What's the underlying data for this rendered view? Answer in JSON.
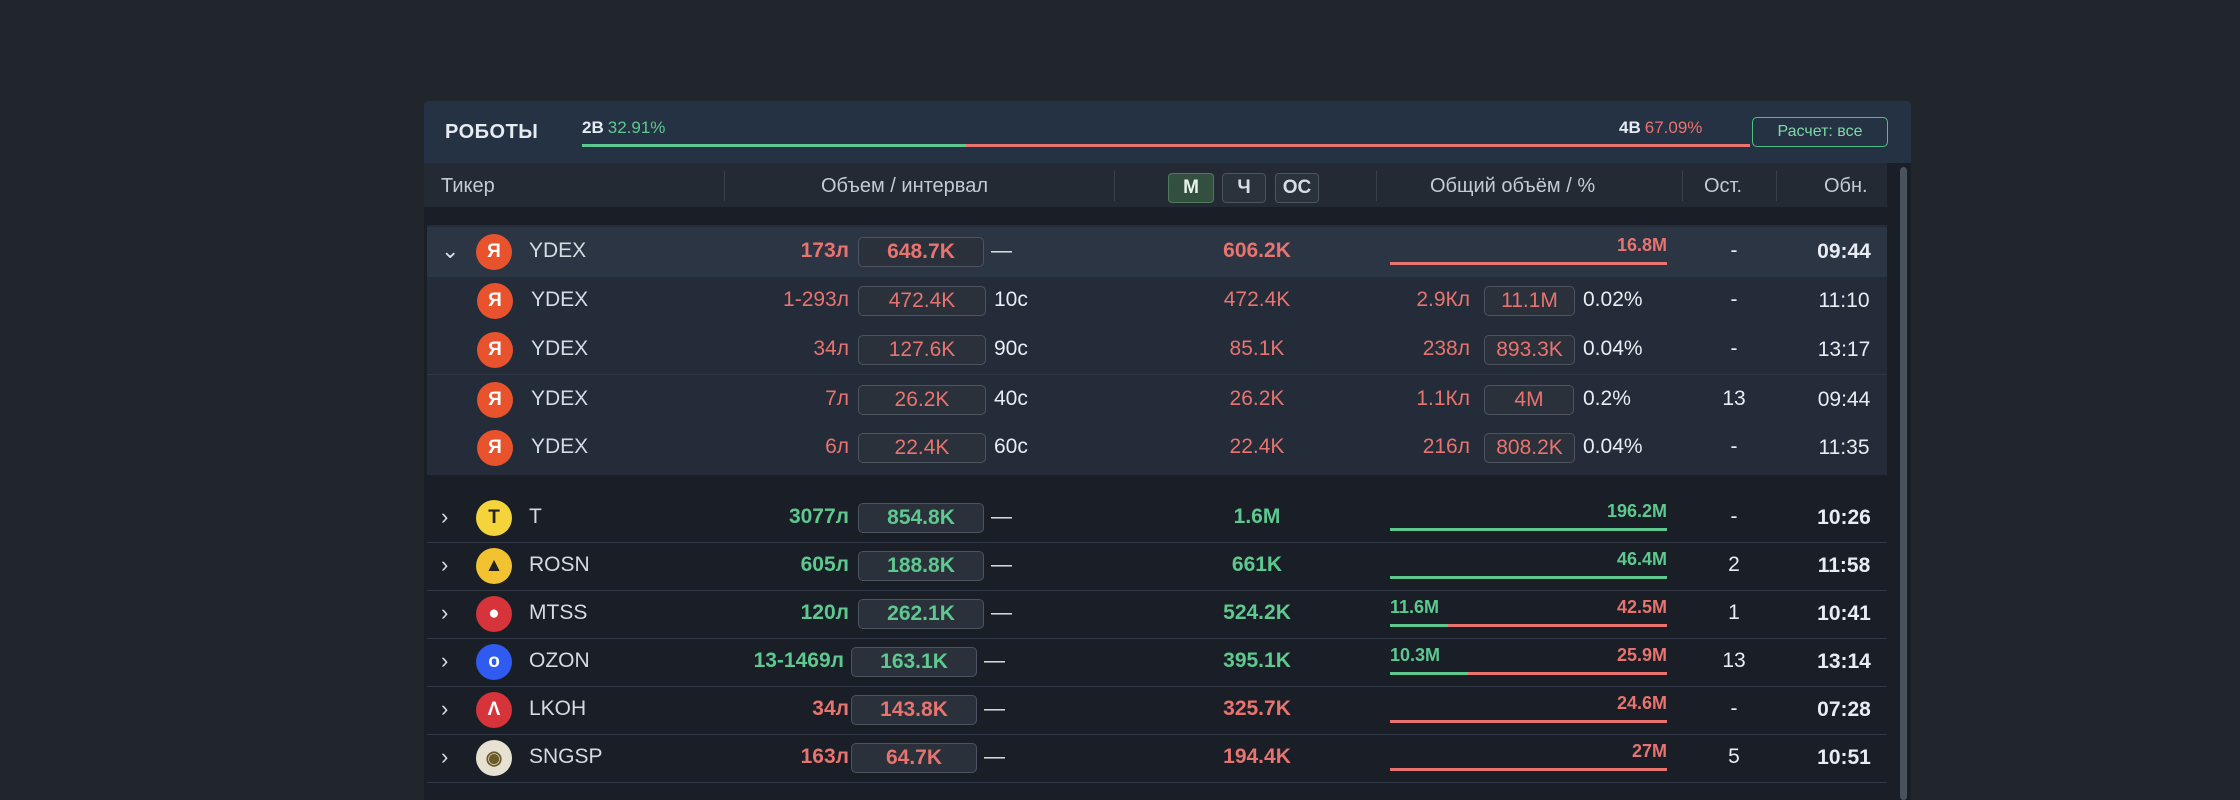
{
  "robots": {
    "title": "РОБОТЫ",
    "buy_label": "2B",
    "buy_pct": "32.91%",
    "buy_fraction": 0.3291,
    "sell_label": "4B",
    "sell_pct": "67.09%",
    "calc_button": "Расчет: все"
  },
  "columns": {
    "ticker": "Тикер",
    "volume_interval": "Объем / интервал",
    "total_volume": "Общий объём / %",
    "remaining": "Ост.",
    "updated": "Обн."
  },
  "mode_buttons": [
    "М",
    "Ч",
    "ОС"
  ],
  "colors": {
    "background": "#21262d",
    "panel": "#1a1f27",
    "buy": "#5ec98f",
    "sell": "#e8736f",
    "ydex": "#e8532e"
  },
  "rows": [
    {
      "kind": "parent",
      "expanded": true,
      "ticker": "YDEX",
      "icon": "yandex-icon",
      "icon_glyph": "Я",
      "lots": "173л",
      "volume": "648.7K",
      "interval": "—",
      "mid": "606.2K",
      "total_left": "",
      "total_right": "16.8M",
      "remaining": "-",
      "updated": "09:44"
    },
    {
      "kind": "child",
      "ticker": "YDEX",
      "icon": "yandex-icon",
      "icon_glyph": "Я",
      "lots": "1-293л",
      "volume": "472.4K",
      "interval": "10с",
      "mid": "472.4K",
      "total_lots": "2.9Кл",
      "total_pill": "11.1M",
      "pct": "0.02%",
      "remaining": "-",
      "updated": "11:10"
    },
    {
      "kind": "child",
      "ticker": "YDEX",
      "icon": "yandex-icon",
      "icon_glyph": "Я",
      "lots": "34л",
      "volume": "127.6K",
      "interval": "90с",
      "mid": "85.1K",
      "total_lots": "238л",
      "total_pill": "893.3K",
      "pct": "0.04%",
      "remaining": "-",
      "updated": "13:17"
    },
    {
      "kind": "child",
      "ticker": "YDEX",
      "icon": "yandex-icon",
      "icon_glyph": "Я",
      "lots": "7л",
      "volume": "26.2K",
      "interval": "40с",
      "mid": "26.2K",
      "total_lots": "1.1Кл",
      "total_pill": "4M",
      "pct": "0.2%",
      "remaining": "13",
      "updated": "09:44"
    },
    {
      "kind": "child",
      "ticker": "YDEX",
      "icon": "yandex-icon",
      "icon_glyph": "Я",
      "lots": "6л",
      "volume": "22.4K",
      "interval": "60с",
      "mid": "22.4K",
      "total_lots": "216л",
      "total_pill": "808.2K",
      "pct": "0.04%",
      "remaining": "-",
      "updated": "11:35"
    },
    {
      "kind": "parent",
      "ticker": "T",
      "icon": "tbank-icon",
      "icon_glyph": "T",
      "lots": "3077л",
      "volume": "854.8K",
      "interval": "—",
      "mid": "1.6M",
      "total_left": "",
      "total_right": "196.2M",
      "remaining": "-",
      "updated": "10:26",
      "tone": "green",
      "bar_green": 1.0
    },
    {
      "kind": "parent",
      "ticker": "ROSN",
      "icon": "rosneft-icon",
      "icon_glyph": "▲",
      "lots": "605л",
      "volume": "188.8K",
      "interval": "—",
      "mid": "661K",
      "total_left": "",
      "total_right": "46.4M",
      "remaining": "2",
      "updated": "11:58",
      "tone": "green",
      "bar_green": 1.0
    },
    {
      "kind": "parent",
      "ticker": "MTSS",
      "icon": "mts-icon",
      "icon_glyph": "●",
      "lots": "120л",
      "volume": "262.1K",
      "interval": "—",
      "mid": "524.2K",
      "total_left": "11.6M",
      "total_right": "42.5M",
      "remaining": "1",
      "updated": "10:41",
      "tone": "green",
      "bar_green": 0.21
    },
    {
      "kind": "parent",
      "ticker": "OZON",
      "icon": "ozon-icon",
      "icon_glyph": "o",
      "lots": "13-1469л",
      "volume": "163.1K",
      "interval": "—",
      "mid": "395.1K",
      "total_left": "10.3M",
      "total_right": "25.9M",
      "remaining": "13",
      "updated": "13:14",
      "tone": "green",
      "bar_green": 0.28
    },
    {
      "kind": "parent",
      "ticker": "LKOH",
      "icon": "lukoil-icon",
      "icon_glyph": "Ʌ",
      "lots": "34л",
      "volume": "143.8K",
      "interval": "—",
      "mid": "325.7K",
      "total_left": "",
      "total_right": "24.6M",
      "remaining": "-",
      "updated": "07:28",
      "tone": "red",
      "bar_green": 0
    },
    {
      "kind": "parent",
      "ticker": "SNGSP",
      "icon": "surgut-icon",
      "icon_glyph": "◉",
      "lots": "163л",
      "volume": "64.7K",
      "interval": "—",
      "mid": "194.4K",
      "total_left": "",
      "total_right": "27M",
      "remaining": "5",
      "updated": "10:51",
      "tone": "red",
      "bar_green": 0
    }
  ]
}
